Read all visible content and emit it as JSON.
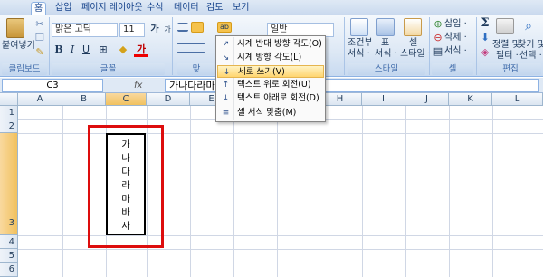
{
  "tabs": [
    "홈",
    "삽입",
    "페이지 레이아웃",
    "수식",
    "데이터",
    "검토",
    "보기"
  ],
  "clipboard": {
    "paste_label": "붙여넣기",
    "group_label": "클립보드"
  },
  "font": {
    "name": "맑은 고딕",
    "size": "11",
    "group_label": "글꼴",
    "bold": "B",
    "italic": "I",
    "underline": "U",
    "grow": "가",
    "shrink": "가",
    "color_glyph": "가"
  },
  "alignment": {
    "group_label": "맞"
  },
  "number": {
    "format": "일반"
  },
  "styles": {
    "conditional": "조건부",
    "conditional2": "서식 ·",
    "table": "표",
    "table2": "서식 ·",
    "cell": "셀",
    "cell2": "스타일 ·",
    "group_label": "스타일"
  },
  "cells": {
    "insert": "삽입 ·",
    "delete": "삭제 ·",
    "format": "서식 ·",
    "group_label": "셀"
  },
  "editing": {
    "sort": "정렬 및",
    "sort2": "필터 ·",
    "find": "찾기 및",
    "find2": "선택 ·",
    "group_label": "편집",
    "sigma": "Σ"
  },
  "formula_bar": {
    "name_box": "C3",
    "fx": "fx",
    "content": "가나다라마"
  },
  "columns": [
    "A",
    "B",
    "C",
    "D",
    "E",
    "F",
    "G",
    "H",
    "I",
    "J",
    "K",
    "L"
  ],
  "rows": [
    "1",
    "2",
    "3",
    "4",
    "5",
    "6"
  ],
  "cell_c3_text": "가\n나\n다\n라\n마\n바\n사",
  "menu_items": [
    "시계 반대 방향 각도(O)",
    "시계 방향 각도(L)",
    "세로 쓰기(V)",
    "텍스트 위로 회전(U)",
    "텍스트 아래로 회전(D)",
    "셀 서식 맞춤(M)"
  ],
  "highlighted_menu_item": "세로 쓰기(V)",
  "colors": {
    "accent_red": "#dd0d0d",
    "selection_header": "#f1c15f",
    "ribbon_bg": "#dde8f5"
  }
}
